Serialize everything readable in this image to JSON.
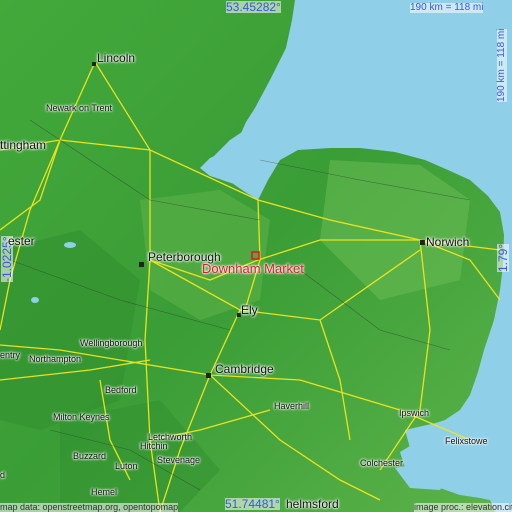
{
  "map": {
    "coords": {
      "lat_top": "53.45282°",
      "lat_bottom": "51.74481°",
      "lon_left": "-1.0225°",
      "lon_right": "1.79°"
    },
    "scale_horizontal": "190 km = 118 mi",
    "scale_vertical": "190 km = 118 mi",
    "highlight": {
      "name": "Downham Market",
      "color": "#e5182b"
    },
    "cities": [
      {
        "id": "lincoln",
        "label": "Lincoln"
      },
      {
        "id": "newark",
        "label": "Newark on Trent"
      },
      {
        "id": "nottingham",
        "label": "ttingham"
      },
      {
        "id": "leicester",
        "label": "ester"
      },
      {
        "id": "peterborough",
        "label": "Peterborough"
      },
      {
        "id": "ely",
        "label": "Ely"
      },
      {
        "id": "norwich",
        "label": "Norwich"
      },
      {
        "id": "cambridge",
        "label": "Cambridge"
      },
      {
        "id": "wellingborough",
        "label": "Wellingborough"
      },
      {
        "id": "northampton",
        "label": "Northampton"
      },
      {
        "id": "entry",
        "label": "entry"
      },
      {
        "id": "bedford",
        "label": "Bedford"
      },
      {
        "id": "haverhill",
        "label": "Haverhill"
      },
      {
        "id": "ipswich",
        "label": "Ipswich"
      },
      {
        "id": "felixstowe",
        "label": "Felixstowe"
      },
      {
        "id": "milton-keynes",
        "label": "Milton Keynes"
      },
      {
        "id": "letchworth",
        "label": "Letchworth"
      },
      {
        "id": "hitchin",
        "label": "Hitchin"
      },
      {
        "id": "stevenage",
        "label": "Stevenage"
      },
      {
        "id": "buzzard",
        "label": "Buzzard"
      },
      {
        "id": "luton",
        "label": "Luton"
      },
      {
        "id": "colchester",
        "label": "Colchester"
      },
      {
        "id": "hemel",
        "label": "Hemel"
      },
      {
        "id": "chelmsford",
        "label": "helmsford"
      },
      {
        "id": "d",
        "label": "d"
      }
    ],
    "attribution_left": "map data: openstreetmap.org, opentopomap",
    "attribution_right": "image proc.: elevation.city",
    "colors": {
      "sea": "#8fd0e8",
      "land": "#3fa53a",
      "roads": "#f4e61a",
      "labels_coord": "#3b56e0"
    }
  }
}
